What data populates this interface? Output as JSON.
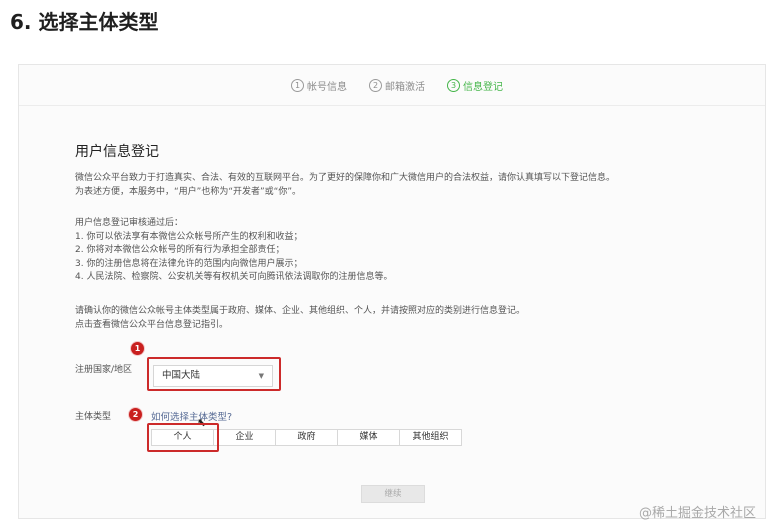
{
  "heading": "6. 选择主体类型",
  "steps": [
    {
      "num": "1",
      "label": "帐号信息"
    },
    {
      "num": "2",
      "label": "邮箱激活"
    },
    {
      "num": "3",
      "label": "信息登记"
    }
  ],
  "form": {
    "title": "用户信息登记",
    "intro_lines": [
      "微信公众平台致力于打造真实、合法、有效的互联网平台。为了更好的保障你和广大微信用户的合法权益，请你认真填写以下登记信息。",
      "为表述方便，本服务中，“用户”也称为“开发者”或“你”。"
    ],
    "review_lines": [
      "用户信息登记审核通过后：",
      "1. 你可以依法享有本微信公众帐号所产生的权利和收益；",
      "2. 你将对本微信公众帐号的所有行为承担全部责任；",
      "3. 你的注册信息将在法律允许的范围内向微信用户展示；",
      "4. 人民法院、检察院、公安机关等有权机关可向腾讯依法调取你的注册信息等。"
    ],
    "confirm_lines": [
      "请确认你的微信公众帐号主体类型属于政府、媒体、企业、其他组织、个人，并请按照对应的类别进行信息登记。",
      "点击查看微信公众平台信息登记指引。"
    ],
    "country_label": "注册国家/地区",
    "country_value": "中国大陆",
    "type_label": "主体类型",
    "type_help_link": "如何选择主体类型?",
    "types": [
      "个人",
      "企业",
      "政府",
      "媒体",
      "其他组织"
    ],
    "next_label": "继续"
  },
  "markers": [
    "1",
    "2"
  ],
  "watermark": "@稀土掘金技术社区",
  "colors": {
    "active_step": "#44b549",
    "highlight": "#cc2a2a",
    "link": "#576b95"
  }
}
